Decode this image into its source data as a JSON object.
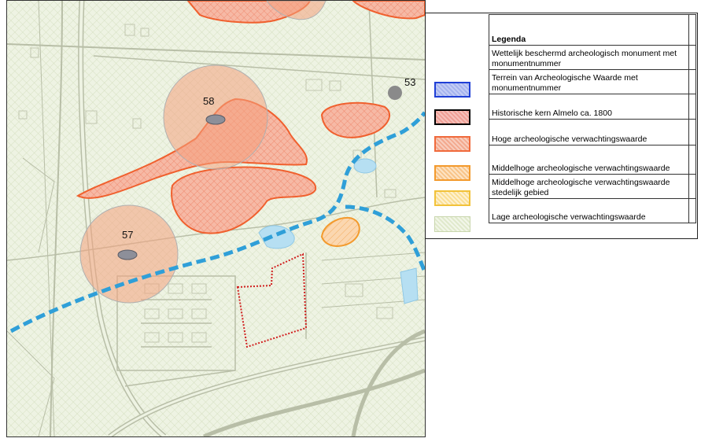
{
  "map": {
    "monument_labels": [
      "53",
      "58",
      "57"
    ]
  },
  "legend": {
    "title": "Legenda",
    "items": [
      {
        "label": "Wettelijk beschermd archeologisch monument met monumentnummer",
        "swatch": "none"
      },
      {
        "label": "Terrein van Archeologische Waarde met monumentnummer",
        "swatch": "blue-hatch",
        "stroke": "#1f3fd6",
        "fill": "#b9c4f3"
      },
      {
        "label": "Historische kern Almelo ca. 1800",
        "swatch": "red-black",
        "stroke": "#000000",
        "fill": "#f3b8b2"
      },
      {
        "label": "Hoge archeologische verwachtingswaarde",
        "swatch": "orange-red",
        "stroke": "#f06a3c",
        "fill": "#f7c2ad"
      },
      {
        "label": "Middelhoge archeologische verwachtingswaarde",
        "swatch": "orange",
        "stroke": "#f39a2d",
        "fill": "#fbd8b0"
      },
      {
        "label": "Middelhoge archeologische verwachtingswaarde stedelijk gebied",
        "swatch": "yellow",
        "stroke": "#f2c23a",
        "fill": "#fdebc0"
      },
      {
        "label": "Lage archeologische verwachtingswaarde",
        "swatch": "green-light",
        "stroke": "#c9d6ad",
        "fill": "#eef3e3"
      }
    ]
  }
}
